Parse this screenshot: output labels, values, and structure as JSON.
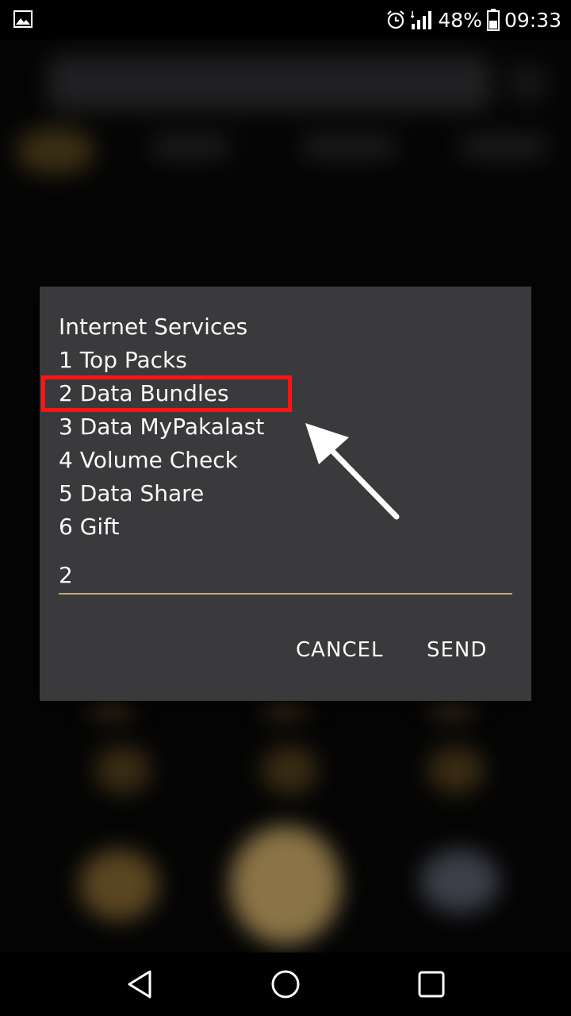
{
  "status_bar": {
    "battery_percent": "48%",
    "time": "09:33",
    "icons": [
      "gallery-icon",
      "alarm-icon",
      "signal-icon",
      "battery-icon"
    ]
  },
  "dialog": {
    "lines": [
      "Internet Services",
      "1 Top Packs",
      "2 Data Bundles",
      "3 Data MyPakalast",
      "4 Volume Check",
      "5 Data Share",
      "6 Gift"
    ],
    "highlighted_line": "2 Data Bundles",
    "input_value": "2",
    "cancel_label": "CANCEL",
    "send_label": "SEND"
  },
  "colors": {
    "dialog_bg": "#3a3a3c",
    "highlight": "#ff1414",
    "input_underline": "#c8a876"
  },
  "nav_bar": {
    "icons": [
      "back-icon",
      "home-icon",
      "recent-apps-icon"
    ]
  }
}
